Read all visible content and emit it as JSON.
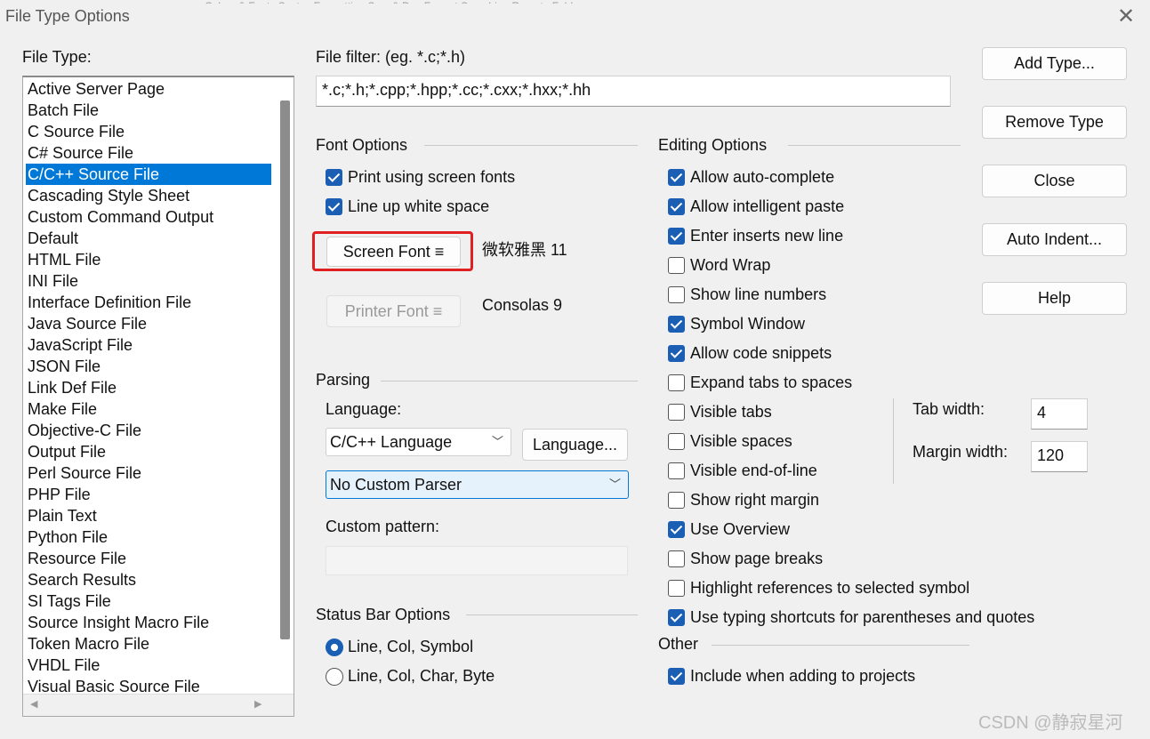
{
  "window": {
    "title": "File Type Options",
    "title_strip": "Colors & Fonts     Syntax Formatting     Sym & Doc Format     Searching     Remote     Folders"
  },
  "file_type": {
    "label": "File Type:",
    "items": [
      "Active Server Page",
      "Batch File",
      "C Source File",
      "C# Source File",
      "C/C++ Source File",
      "Cascading Style Sheet",
      "Custom Command Output",
      "Default",
      "HTML File",
      "INI File",
      "Interface Definition File",
      "Java Source File",
      "JavaScript File",
      "JSON File",
      "Link Def File",
      "Make File",
      "Objective-C File",
      "Output File",
      "Perl Source File",
      "PHP File",
      "Plain Text",
      "Python File",
      "Resource File",
      "Search Results",
      "SI Tags File",
      "Source Insight Macro File",
      "Token Macro File",
      "VHDL File",
      "Visual Basic Source File"
    ],
    "selected_index": 4
  },
  "file_filter": {
    "label": "File filter: (eg. *.c;*.h)",
    "value": "*.c;*.h;*.cpp;*.hpp;*.cc;*.cxx;*.hxx;*.hh"
  },
  "font_options": {
    "title": "Font Options",
    "print_screen_fonts": {
      "label": "Print using screen fonts",
      "checked": true
    },
    "line_up_white_space": {
      "label": "Line up white space",
      "checked": true
    },
    "screen_font_button": "Screen Font  ≡",
    "screen_font_value": "微软雅黑 11",
    "printer_font_button": "Printer Font  ≡",
    "printer_font_value": "Consolas 9"
  },
  "parsing": {
    "title": "Parsing",
    "language_label": "Language:",
    "language_value": "C/C++ Language",
    "language_button": "Language...",
    "parser_value": "No Custom Parser",
    "custom_pattern_label": "Custom pattern:",
    "custom_pattern_value": ""
  },
  "status_bar": {
    "title": "Status Bar Options",
    "options": [
      {
        "label": "Line, Col, Symbol",
        "selected": true
      },
      {
        "label": "Line, Col, Char, Byte",
        "selected": false
      }
    ]
  },
  "editing": {
    "title": "Editing Options",
    "options": [
      {
        "label": "Allow auto-complete",
        "checked": true
      },
      {
        "label": "Allow intelligent paste",
        "checked": true
      },
      {
        "label": "Enter inserts new line",
        "checked": true
      },
      {
        "label": "Word Wrap",
        "checked": false
      },
      {
        "label": "Show line numbers",
        "checked": false
      },
      {
        "label": "Symbol Window",
        "checked": true
      },
      {
        "label": "Allow code snippets",
        "checked": true
      },
      {
        "label": "Expand tabs to spaces",
        "checked": false
      },
      {
        "label": "Visible tabs",
        "checked": false
      },
      {
        "label": "Visible spaces",
        "checked": false
      },
      {
        "label": "Visible end-of-line",
        "checked": false
      },
      {
        "label": "Show right margin",
        "checked": false
      },
      {
        "label": "Use Overview",
        "checked": true
      },
      {
        "label": "Show page breaks",
        "checked": false
      },
      {
        "label": "Highlight references to selected symbol",
        "checked": false
      },
      {
        "label": "Use typing shortcuts for parentheses and quotes",
        "checked": true
      }
    ],
    "tab_width_label": "Tab width:",
    "tab_width_value": "4",
    "margin_width_label": "Margin width:",
    "margin_width_value": "120"
  },
  "other": {
    "title": "Other",
    "include_when_adding": {
      "label": "Include when adding to projects",
      "checked": true
    }
  },
  "buttons": {
    "add_type": "Add Type...",
    "remove_type": "Remove Type",
    "close": "Close",
    "auto_indent": "Auto Indent...",
    "help": "Help"
  },
  "watermark": "CSDN @静寂星河",
  "colors": {
    "selection": "#0078d7",
    "checkbox": "#1a5fb4",
    "highlight_box": "#e02020"
  }
}
